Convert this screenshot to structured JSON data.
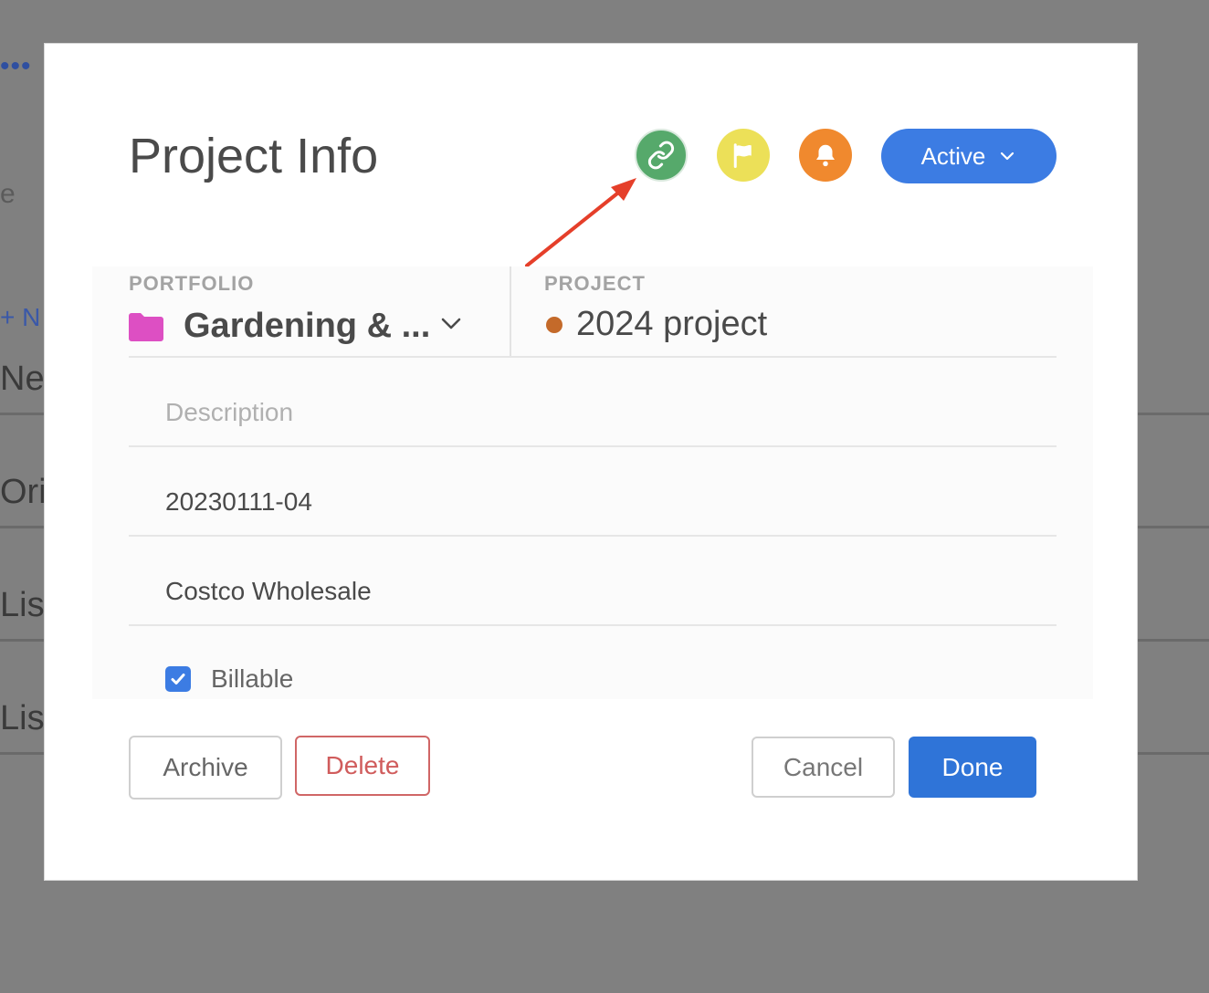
{
  "background": {
    "dots": "•••",
    "fragment_e": "e",
    "new_link": "+ N",
    "rows": [
      "Nev",
      "Orij",
      "List",
      "List"
    ]
  },
  "modal": {
    "title": "Project Info",
    "icons": {
      "link": "link-icon",
      "flag": "flag-icon",
      "bell": "bell-icon"
    },
    "status": {
      "label": "Active"
    },
    "portfolio": {
      "label": "PORTFOLIO",
      "value": "Gardening & ...",
      "folder_color": "#dd4fc3"
    },
    "project": {
      "label": "PROJECT",
      "value": "2024 project",
      "dot_color": "#c46a2a"
    },
    "fields": {
      "description_placeholder": "Description",
      "code": "20230111-04",
      "client": "Costco Wholesale"
    },
    "billable": {
      "label": "Billable",
      "checked": true
    },
    "buttons": {
      "archive": "Archive",
      "delete": "Delete",
      "cancel": "Cancel",
      "done": "Done"
    }
  },
  "colors": {
    "accent": "#3c7ce3",
    "link_green": "#56a96b",
    "flag_yellow": "#ece058",
    "bell_orange": "#f0892e",
    "annotation_arrow": "#e53f2a"
  }
}
